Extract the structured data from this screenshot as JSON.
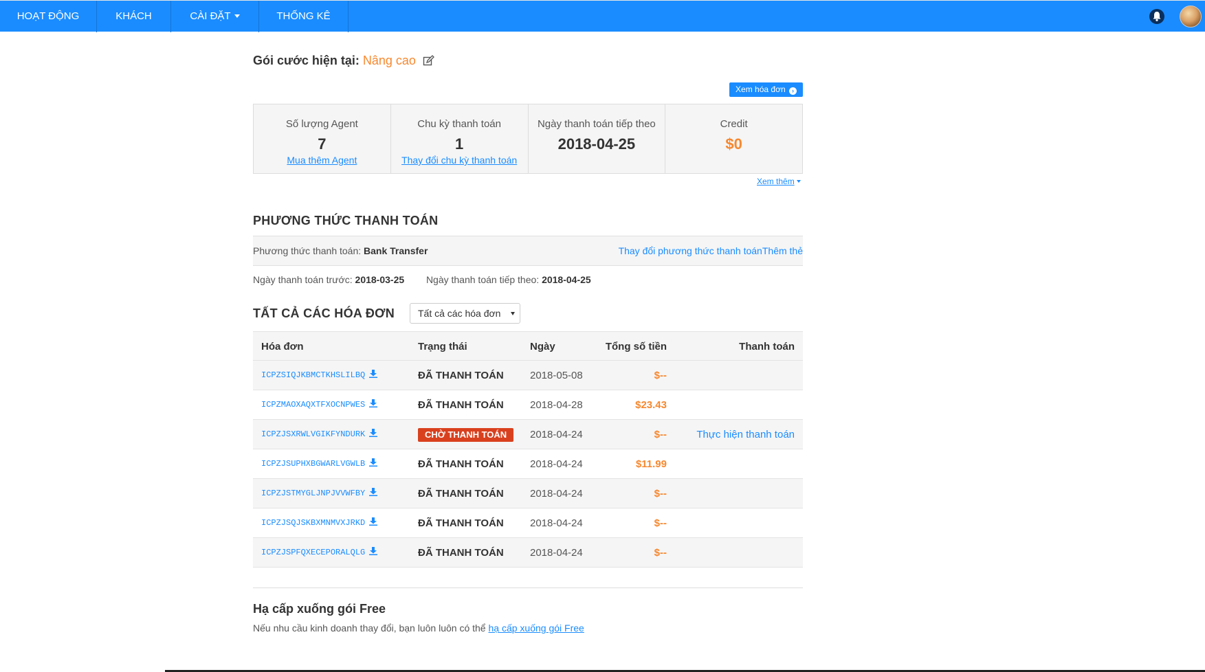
{
  "nav": {
    "items": [
      "HOẠT ĐỘNG",
      "KHÁCH",
      "CÀI ĐẶT",
      "THỐNG KÊ"
    ],
    "bell_icon": "bell-icon",
    "avatar_icon": "user-avatar"
  },
  "plan": {
    "label": "Gói cước hiện tại:",
    "name": "Nâng cao",
    "edit_icon": "edit-icon"
  },
  "invoice_button": "Xem hóa đơn",
  "stats": [
    {
      "label": "Số lượng Agent",
      "value": "7",
      "link": "Mua thêm Agent"
    },
    {
      "label": "Chu kỳ thanh toán",
      "value": "1",
      "link": "Thay đổi chu kỳ thanh toán"
    },
    {
      "label": "Ngày thanh toán tiếp theo",
      "value": "2018-04-25",
      "link": ""
    },
    {
      "label": "Credit",
      "value": "$0",
      "link": ""
    }
  ],
  "see_more": "Xem thêm",
  "payment": {
    "heading": "PHƯƠNG THỨC THANH TOÁN",
    "method_label": "Phương thức thanh toán:",
    "method_value": "Bank Transfer",
    "change_link": "Thay đổi phương thức thanh toán",
    "add_card_link": "Thêm thẻ",
    "prev_label": "Ngày thanh toán trước:",
    "prev_value": "2018-03-25",
    "next_label": "Ngày thanh toán tiếp theo:",
    "next_value": "2018-04-25"
  },
  "invoices": {
    "heading": "TẤT CẢ CÁC HÓA ĐƠN",
    "filter_value": "Tất cả các hóa đơn",
    "columns": [
      "Hóa đơn",
      "Trạng thái",
      "Ngày",
      "Tổng số tiền",
      "Thanh toán"
    ],
    "rows": [
      {
        "id": "ICPZSIQJKBMCTKHSLILBQ",
        "status": "ĐÃ THANH TOÁN",
        "date": "2018-05-08",
        "total": "$--",
        "action": ""
      },
      {
        "id": "ICPZMAOXAQXTFXOCNPWES",
        "status": "ĐÃ THANH TOÁN",
        "date": "2018-04-28",
        "total": "$23.43",
        "action": ""
      },
      {
        "id": "ICPZJSXRWLVGIKFYNDURK",
        "status": "CHỜ THANH TOÁN",
        "date": "2018-04-24",
        "total": "$--",
        "action": "Thực hiện thanh toán"
      },
      {
        "id": "ICPZJSUPHXBGWARLVGWLB",
        "status": "ĐÃ THANH TOÁN",
        "date": "2018-04-24",
        "total": "$11.99",
        "action": ""
      },
      {
        "id": "ICPZJSTMYGLJNPJVVWFBY",
        "status": "ĐÃ THANH TOÁN",
        "date": "2018-04-24",
        "total": "$--",
        "action": ""
      },
      {
        "id": "ICPZJSQJSKBXMNMVXJRKD",
        "status": "ĐÃ THANH TOÁN",
        "date": "2018-04-24",
        "total": "$--",
        "action": ""
      },
      {
        "id": "ICPZJSPFQXECEPORALQLG",
        "status": "ĐÃ THANH TOÁN",
        "date": "2018-04-24",
        "total": "$--",
        "action": ""
      }
    ]
  },
  "downgrade": {
    "title": "Hạ cấp xuống gói Free",
    "text": "Nếu nhu cầu kinh doanh thay đổi, bạn luôn luôn có thể",
    "link": "hạ cấp xuống gói Free"
  },
  "colors": {
    "primary": "#1a8cff",
    "accent_orange": "#f7882f",
    "pending_badge": "#d9411e"
  }
}
